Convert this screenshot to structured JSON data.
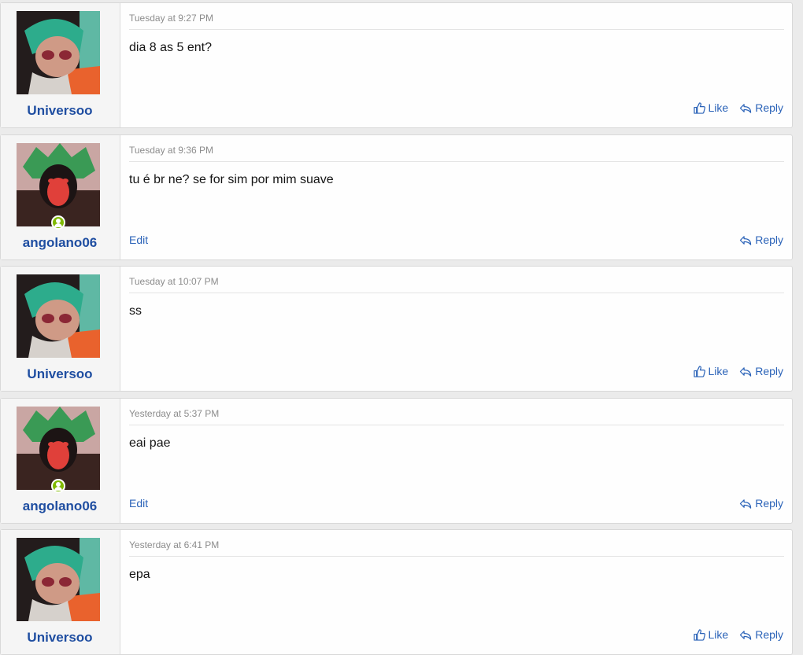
{
  "actions": {
    "like": "Like",
    "reply": "Reply",
    "edit": "Edit"
  },
  "posts": [
    {
      "user": "Universoo",
      "time": "Tuesday at 9:27 PM",
      "message": "dia 8 as 5 ent?",
      "own": false
    },
    {
      "user": "angolano06",
      "time": "Tuesday at 9:36 PM",
      "message": "tu é br ne? se for sim por mim suave",
      "own": true
    },
    {
      "user": "Universoo",
      "time": "Tuesday at 10:07 PM",
      "message": "ss",
      "own": false
    },
    {
      "user": "angolano06",
      "time": "Yesterday at 5:37 PM",
      "message": "eai pae",
      "own": true
    },
    {
      "user": "Universoo",
      "time": "Yesterday at 6:41 PM",
      "message": "epa",
      "own": false
    }
  ],
  "colors": {
    "link": "#2b63b8",
    "username": "#1f4ea1",
    "online": "#7fb900"
  }
}
